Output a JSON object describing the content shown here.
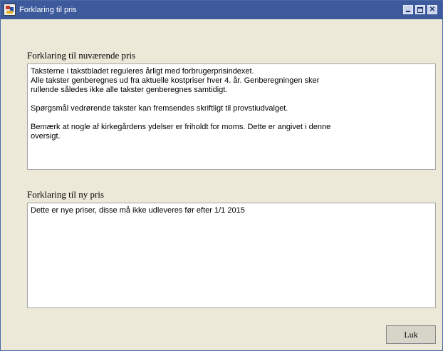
{
  "window": {
    "title": "Forklaring til pris",
    "icon": "app-icon",
    "controls": [
      "minimize-icon",
      "maximize-icon",
      "close-icon"
    ],
    "titlebar_color": "#3d5a9c"
  },
  "current_price": {
    "label": "Forklaring til nuværende pris",
    "lines": [
      "Taksterne i takstbladet reguleres årligt med forbrugerprisindexet.",
      "Alle takster genberegnes ud fra aktuelle kostpriser hver 4. år. Genberegningen sker",
      "rullende således ikke alle takster genberegnes samtidigt.",
      "",
      "Spørgsmål vedrørende takster kan fremsendes skriftligt til provstiudvalget.",
      "",
      "Bemærk at nogle af kirkegårdens ydelser er friholdt for moms. Dette er angivet i denne",
      "oversigt."
    ]
  },
  "new_price": {
    "label": "Forklaring til ny pris",
    "text": "Dette er nye priser, disse må ikke udleveres før efter 1/1 2015"
  },
  "buttons": {
    "close_label": "Luk"
  }
}
